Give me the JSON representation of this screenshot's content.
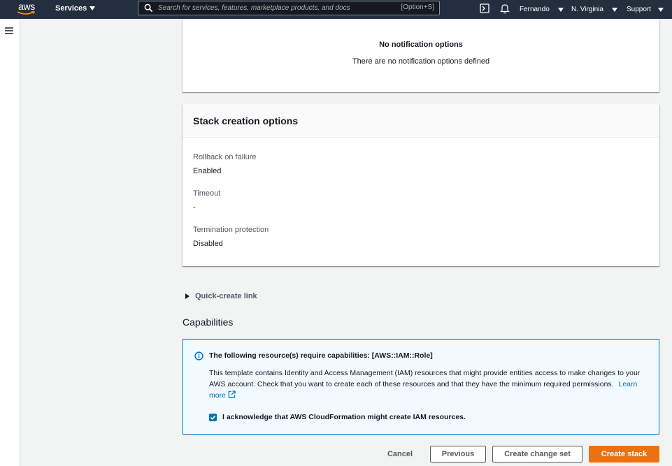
{
  "topnav": {
    "logo_text": "aws",
    "services_label": "Services",
    "search_placeholder": "Search for services, features, marketplace products, and docs",
    "search_shortcut": "[Option+S]",
    "user_label": "Fernando",
    "region_label": "N. Virginia",
    "support_label": "Support"
  },
  "notifications": {
    "title": "No notification options",
    "description": "There are no notification options defined"
  },
  "stack_options": {
    "heading": "Stack creation options",
    "fields": [
      {
        "label": "Rollback on failure",
        "value": "Enabled"
      },
      {
        "label": "Timeout",
        "value": "-"
      },
      {
        "label": "Termination protection",
        "value": "Disabled"
      }
    ]
  },
  "quick_create": {
    "label": "Quick-create link"
  },
  "capabilities": {
    "heading": "Capabilities",
    "alert_title": "The following resource(s) require capabilities: [AWS::IAM::Role]",
    "alert_body": "This template contains Identity and Access Management (IAM) resources that might provide entities access to make changes to your AWS account. Check that you want to create each of these resources and that they have the minimum required permissions.",
    "learn_more": "Learn more",
    "acknowledge_label": "I acknowledge that AWS CloudFormation might create IAM resources.",
    "acknowledge_checked": true
  },
  "actions": {
    "cancel": "Cancel",
    "previous": "Previous",
    "create_change_set": "Create change set",
    "create_stack": "Create stack"
  },
  "colors": {
    "nav_bg": "#232f3e",
    "primary": "#ec7211",
    "link": "#0073bb",
    "info_bg": "#f1faff"
  }
}
